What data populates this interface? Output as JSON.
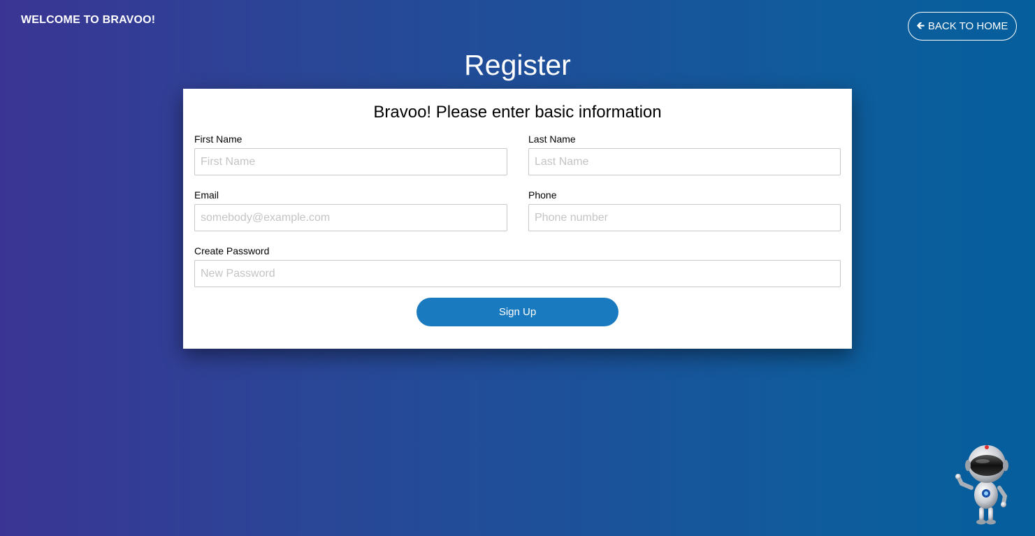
{
  "header": {
    "brand": "WELCOME TO BRAVOO!",
    "back_button": {
      "icon": "arrow-left-icon",
      "label": "BACK TO HOME"
    }
  },
  "page": {
    "title": "Register"
  },
  "form": {
    "heading": "Bravoo! Please enter basic information",
    "first_name": {
      "label": "First Name",
      "placeholder": "First Name",
      "value": ""
    },
    "last_name": {
      "label": "Last Name",
      "placeholder": "Last Name",
      "value": ""
    },
    "email": {
      "label": "Email",
      "placeholder": "somebody@example.com",
      "value": ""
    },
    "phone": {
      "label": "Phone",
      "placeholder": "Phone number",
      "value": ""
    },
    "password": {
      "label": "Create Password",
      "placeholder": "New Password",
      "value": ""
    },
    "submit_label": "Sign Up"
  },
  "mascot": {
    "icon": "robot-mascot-icon"
  },
  "colors": {
    "gradient_start": "#3a3594",
    "gradient_end": "#055f9c",
    "button_primary": "#1a7abf",
    "card_background": "#ffffff"
  }
}
